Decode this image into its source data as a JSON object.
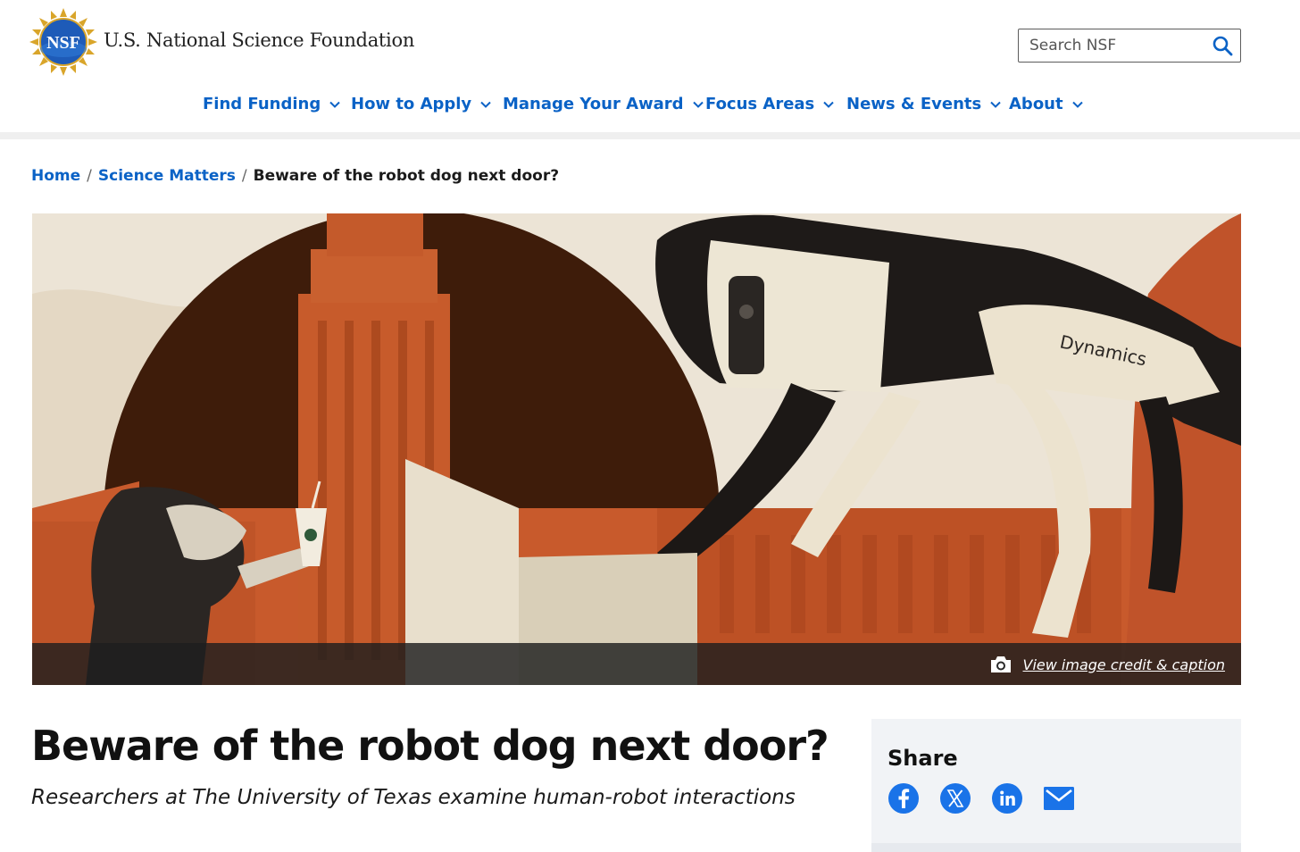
{
  "site": {
    "logo_text": "NSF",
    "name": "U.S. National Science Foundation"
  },
  "search": {
    "placeholder": "Search NSF",
    "icon": "search-icon"
  },
  "nav": {
    "items": [
      {
        "label": "Find Funding",
        "icon": "chevron-down-icon"
      },
      {
        "label": "How to Apply",
        "icon": "chevron-down-icon"
      },
      {
        "label": "Manage Your Award",
        "icon": "chevron-down-icon"
      },
      {
        "label": "Focus Areas",
        "icon": "chevron-down-icon"
      },
      {
        "label": "News & Events",
        "icon": "chevron-down-icon"
      },
      {
        "label": "About",
        "icon": "chevron-down-icon"
      }
    ]
  },
  "breadcrumb": {
    "items": [
      "Home",
      "Science Matters"
    ],
    "current": "Beware of the robot dog next door?"
  },
  "hero": {
    "robot_text": "Dynamics",
    "caption_link": "View image credit & caption",
    "caption_icon": "camera-icon"
  },
  "article": {
    "title": "Beware of the robot dog next door?",
    "subtitle": "Researchers at The University of Texas examine human-robot interactions"
  },
  "share": {
    "title": "Share",
    "icons": [
      "facebook-icon",
      "x-icon",
      "linkedin-icon",
      "email-icon"
    ]
  },
  "colors": {
    "link_blue": "#0a62c6",
    "share_blue": "#1a73e8",
    "hero_orange": "#c85a2c",
    "hero_dark": "#3e1c0a"
  }
}
